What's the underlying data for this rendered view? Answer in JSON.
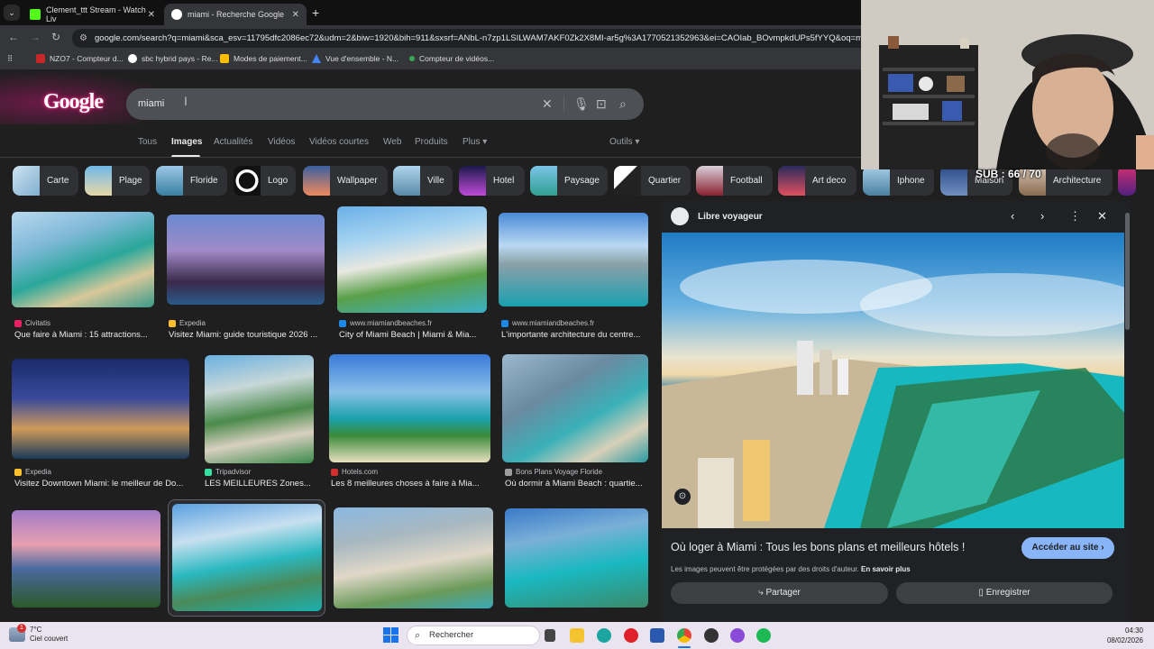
{
  "browser": {
    "tabs": [
      {
        "label": "Clement_ttt Stream - Watch Liv",
        "color": "#53fc18"
      },
      {
        "label": "miami - Recherche Google",
        "color": "#4285f4"
      }
    ],
    "url": "google.com/search?q=miami&sca_esv=11795dfc2086ec72&udm=2&biw=1920&bih=911&sxsrf=ANbL-n7zp1LSILWAM7AKF0Zk2X8MI-ar5g%3A1770521352963&ei=CAOIab_BOvmpkdUPs5fYYQ&oq=mia&gs_lp",
    "bookmarks": [
      "NZO7 - Compteur d...",
      "sbc hybrid pays - Re...",
      "Modes de paiement...",
      "Vue d'ensemble - N...",
      "Compteur de vidéos..."
    ]
  },
  "search": {
    "logo": "Google",
    "query": "miami",
    "tabs": [
      "Tous",
      "Images",
      "Actualités",
      "Vidéos",
      "Vidéos courtes",
      "Web",
      "Produits",
      "Plus",
      "Outils"
    ]
  },
  "chips": [
    "Carte",
    "Plage",
    "Floride",
    "Logo",
    "Wallpaper",
    "Ville",
    "Hotel",
    "Paysage",
    "Quartier",
    "Football",
    "Art deco",
    "Iphone",
    "Maison",
    "Architecture"
  ],
  "results": [
    {
      "source": "Civitatis",
      "title": "Que faire à Miami : 15 attractions...",
      "src_color": "#e91e63"
    },
    {
      "source": "Expedia",
      "title": "Visitez Miami: guide touristique 2026 ...",
      "src_color": "#fbc02d"
    },
    {
      "source": "www.miamiandbeaches.fr",
      "title": "City of Miami Beach | Miami & Mia...",
      "src_color": "#1e88e5"
    },
    {
      "source": "www.miamiandbeaches.fr",
      "title": "L'importante architecture du centre...",
      "src_color": "#1e88e5"
    },
    {
      "source": "Expedia",
      "title": "Visitez Downtown Miami: le meilleur de Do...",
      "src_color": "#fbc02d"
    },
    {
      "source": "Tripadvisor",
      "title": "LES MEILLEURES Zones...",
      "src_color": "#34e0a1"
    },
    {
      "source": "Hotels.com",
      "title": "Les 8 meilleures choses à faire à Mia...",
      "src_color": "#d32f2f"
    },
    {
      "source": "Bons Plans Voyage Floride",
      "title": "Où dormir à Miami Beach : quartie...",
      "src_color": "#9e9e9e"
    }
  ],
  "panel": {
    "site": "Libre voyageur",
    "title": "Où loger à Miami : Tous les bons plans et meilleurs hôtels !",
    "visit": "Accéder au site",
    "copyright": "Les images peuvent être protégées par des droits d'auteur.",
    "learn_more": "En savoir plus",
    "share": "Partager",
    "save": "Enregistrer"
  },
  "overlay": {
    "sub": "SUB : 66 / 70"
  },
  "taskbar": {
    "temp": "7°C",
    "weather": "Ciel couvert",
    "search": "Rechercher",
    "time": "04:30",
    "date": "08/02/2026",
    "badge": "1"
  }
}
